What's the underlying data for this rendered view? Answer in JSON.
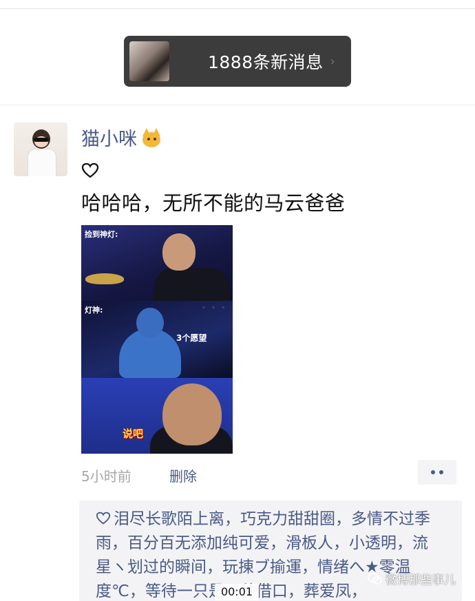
{
  "notification": {
    "text": "1888条新消息"
  },
  "post": {
    "username": "猫小咪",
    "text": "哈哈哈，无所不能的马云爸爸",
    "meme": {
      "panel1_label": "捡到神灯:",
      "panel2_label": "灯神:",
      "panel2_text": "3个愿望",
      "panel3_text": "说吧"
    },
    "time": "5小时前",
    "delete_label": "删除"
  },
  "likes": {
    "text": "泪尽长歌陌上离，巧克力甜甜圈，多情不过季雨，百分百无添加纯可爱，滑板人，小透明，流星ヽ划过的瞬间，玩㨂ブ揄運，情绪へ★零温度℃，等待一只是一种借口，葬爱凤，"
  },
  "watermark": {
    "text": "微博那些事儿"
  },
  "video": {
    "timestamp": "00:01"
  },
  "colors": {
    "link_blue": "#4a5a86",
    "notif_bg": "#3c3c3c",
    "likes_bg": "#f3f3f5"
  }
}
